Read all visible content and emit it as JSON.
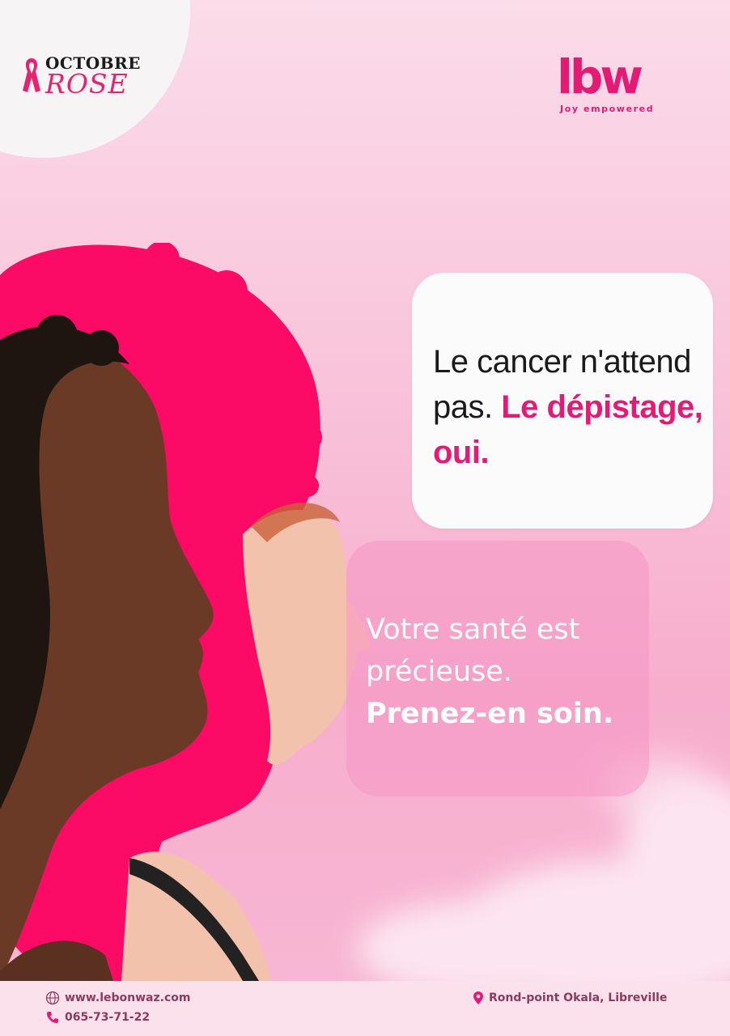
{
  "campaign": {
    "word1": "OCTOBRE",
    "word2": "ROSE"
  },
  "brand": {
    "mark": "lbw",
    "tagline": "Joy empowered"
  },
  "message_card": {
    "line_plain": "Le cancer n'attend pas.",
    "line_highlight": "Le dépistage, oui."
  },
  "health_card": {
    "line_plain": "Votre santé est précieuse.",
    "line_bold": "Prenez-en soin."
  },
  "footer": {
    "website": "www.lebonwaz.com",
    "phone": "065-73-71-22",
    "address": "Rond-point Okala, Libreville"
  },
  "icons": [
    "ribbon-icon",
    "globe-icon",
    "phone-icon",
    "location-pin-icon"
  ],
  "colors": {
    "accent": "#e41a74",
    "background": "#f9c6dc",
    "footer_bg": "#fbe1ec",
    "footer_text": "#8a3c5e"
  }
}
